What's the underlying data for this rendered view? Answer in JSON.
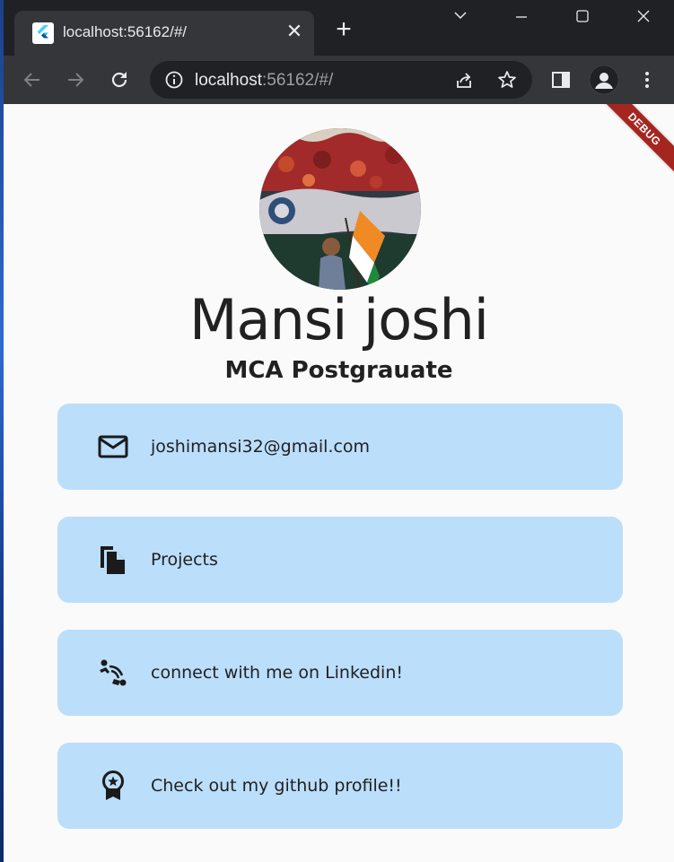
{
  "browser": {
    "tab_title": "localhost:56162/#/",
    "tab_close": "✕",
    "new_tab": "+",
    "url_host": "localhost",
    "url_rest": ":56162/#/"
  },
  "page": {
    "debug_banner": "DEBUG",
    "name": "Mansi joshi",
    "subtitle": "MCA Postgrauate",
    "cards": [
      {
        "label": "joshimansi32@gmail.com",
        "icon": "mail-icon"
      },
      {
        "label": "Projects",
        "icon": "file-copy-icon"
      },
      {
        "label": "connect with me on Linkedin!",
        "icon": "connect-icon"
      },
      {
        "label": "Check out my github profile!!",
        "icon": "badge-icon"
      }
    ]
  },
  "colors": {
    "card_bg": "#bbdefb",
    "debug_banner": "#a5261f",
    "chrome_dark": "#202124",
    "chrome_toolbar": "#35363a"
  }
}
